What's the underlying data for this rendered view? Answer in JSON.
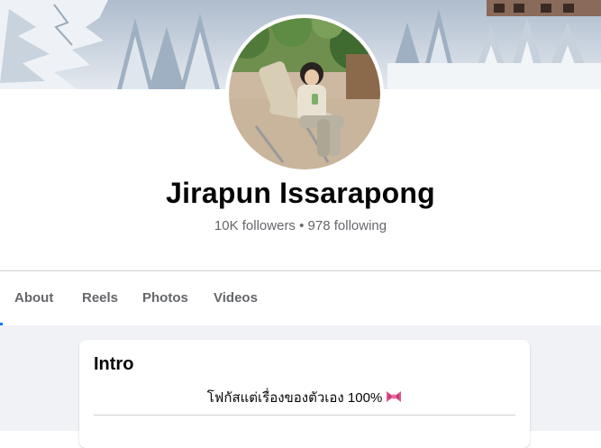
{
  "profile": {
    "name": "Jirapun Issarapong",
    "followers": "10K followers",
    "separator": "•",
    "following": "978 following"
  },
  "tabs": [
    {
      "label": "About"
    },
    {
      "label": "Reels"
    },
    {
      "label": "Photos"
    },
    {
      "label": "Videos"
    }
  ],
  "intro": {
    "title": "Intro",
    "bio": "โฟกัสแต่เรื่องของตัวเอง 100%",
    "bio_emoji": "ribbon-icon"
  },
  "colors": {
    "text_primary": "#050505",
    "text_secondary": "#65676b",
    "accent": "#1877f2",
    "page_background": "#f0f2f5",
    "divider": "#ced0d4"
  }
}
